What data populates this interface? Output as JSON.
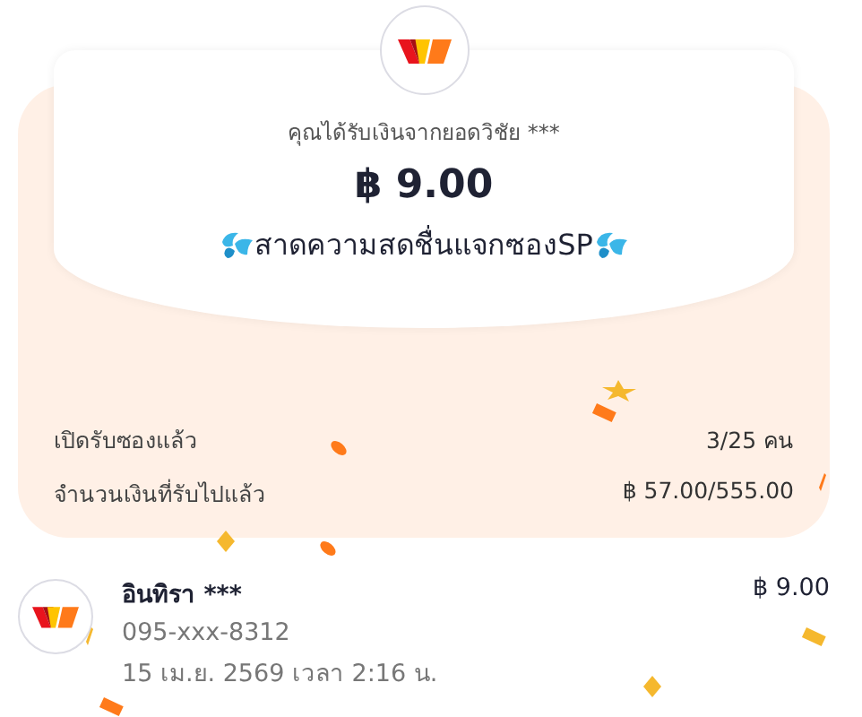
{
  "header": {
    "message": "คุณได้รับเงินจากยอดวิชัย ***",
    "amount": "฿ 9.00",
    "blessing": "สาดความสดชื่นแจกซองSP"
  },
  "stats": [
    {
      "label": "เปิดรับซองแล้ว",
      "value": "3/25 คน"
    },
    {
      "label": "จำนวนเงินที่รับไปแล้ว",
      "value": "฿ 57.00/555.00"
    }
  ],
  "recipients": [
    {
      "name": "อินทิรา ***",
      "phone": "095-xxx-8312",
      "time": "15 เม.ย. 2569 เวลา 2:16 น.",
      "amount": "฿ 9.00"
    }
  ]
}
